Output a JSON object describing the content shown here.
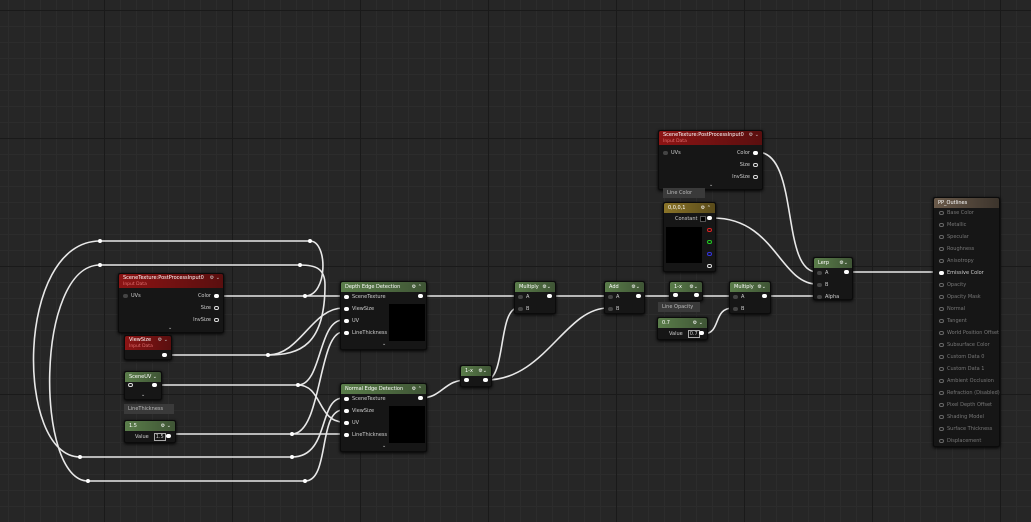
{
  "scene_texture_left": {
    "title": "SceneTexture:PostProcessInput0",
    "subtitle": "Input Data",
    "inputs": [
      "UVs"
    ],
    "outputs": [
      "Color",
      "Size",
      "InvSize"
    ]
  },
  "view_size": {
    "title": "ViewSize",
    "subtitle": "Input Data"
  },
  "scene_uv": {
    "title": "SceneUV"
  },
  "line_thickness_comment": "LineThickness",
  "line_thickness_param": {
    "title": "1.5",
    "value_label": "Value",
    "value": "1.5"
  },
  "depth_edge": {
    "title": "Depth Edge Detection",
    "inputs": [
      "SceneTexture",
      "ViewSize",
      "UV",
      "LineThickness"
    ]
  },
  "normal_edge": {
    "title": "Normal Edge Detection",
    "inputs": [
      "SceneTexture",
      "ViewSize",
      "UV",
      "LineThickness"
    ]
  },
  "one_minus_a": {
    "title": "1-x"
  },
  "multiply_a": {
    "title": "Multiply",
    "inputs": [
      "A",
      "B"
    ]
  },
  "add": {
    "title": "Add",
    "inputs": [
      "A",
      "B"
    ]
  },
  "one_minus_b": {
    "title": "1-x"
  },
  "line_opacity_comment": "Line Opacity",
  "line_opacity_param": {
    "title": "0.7",
    "value_label": "Value",
    "value": "0.7"
  },
  "multiply_b": {
    "title": "Multiply",
    "inputs": [
      "A",
      "B"
    ]
  },
  "scene_texture_right": {
    "title": "SceneTexture:PostProcessInput0",
    "subtitle": "Input Data",
    "inputs": [
      "UVs"
    ],
    "outputs": [
      "Color",
      "Size",
      "InvSize"
    ]
  },
  "line_color_comment": "Line Color",
  "line_color_const": {
    "title": "0,0,0,1",
    "label": "Constant"
  },
  "lerp": {
    "title": "Lerp",
    "inputs": [
      "A",
      "B",
      "Alpha"
    ]
  },
  "output": {
    "title": "PP_Outlines",
    "pins": [
      "Base Color",
      "Metallic",
      "Specular",
      "Roughness",
      "Anisotropy",
      "Emissive Color",
      "Opacity",
      "Opacity Mask",
      "Normal",
      "Tangent",
      "World Position Offset",
      "Subsurface Color",
      "Custom Data 0",
      "Custom Data 1",
      "Ambient Occlusion",
      "Refraction (Disabled)",
      "Pixel Depth Offset",
      "Shading Model",
      "Surface Thickness",
      "Displacement"
    ],
    "active_pin": "Emissive Color"
  },
  "colors": {
    "background": "#262626",
    "input_node": "#8c1414",
    "function_node": "#5a7d4a",
    "vector_node": "#8a7428"
  }
}
